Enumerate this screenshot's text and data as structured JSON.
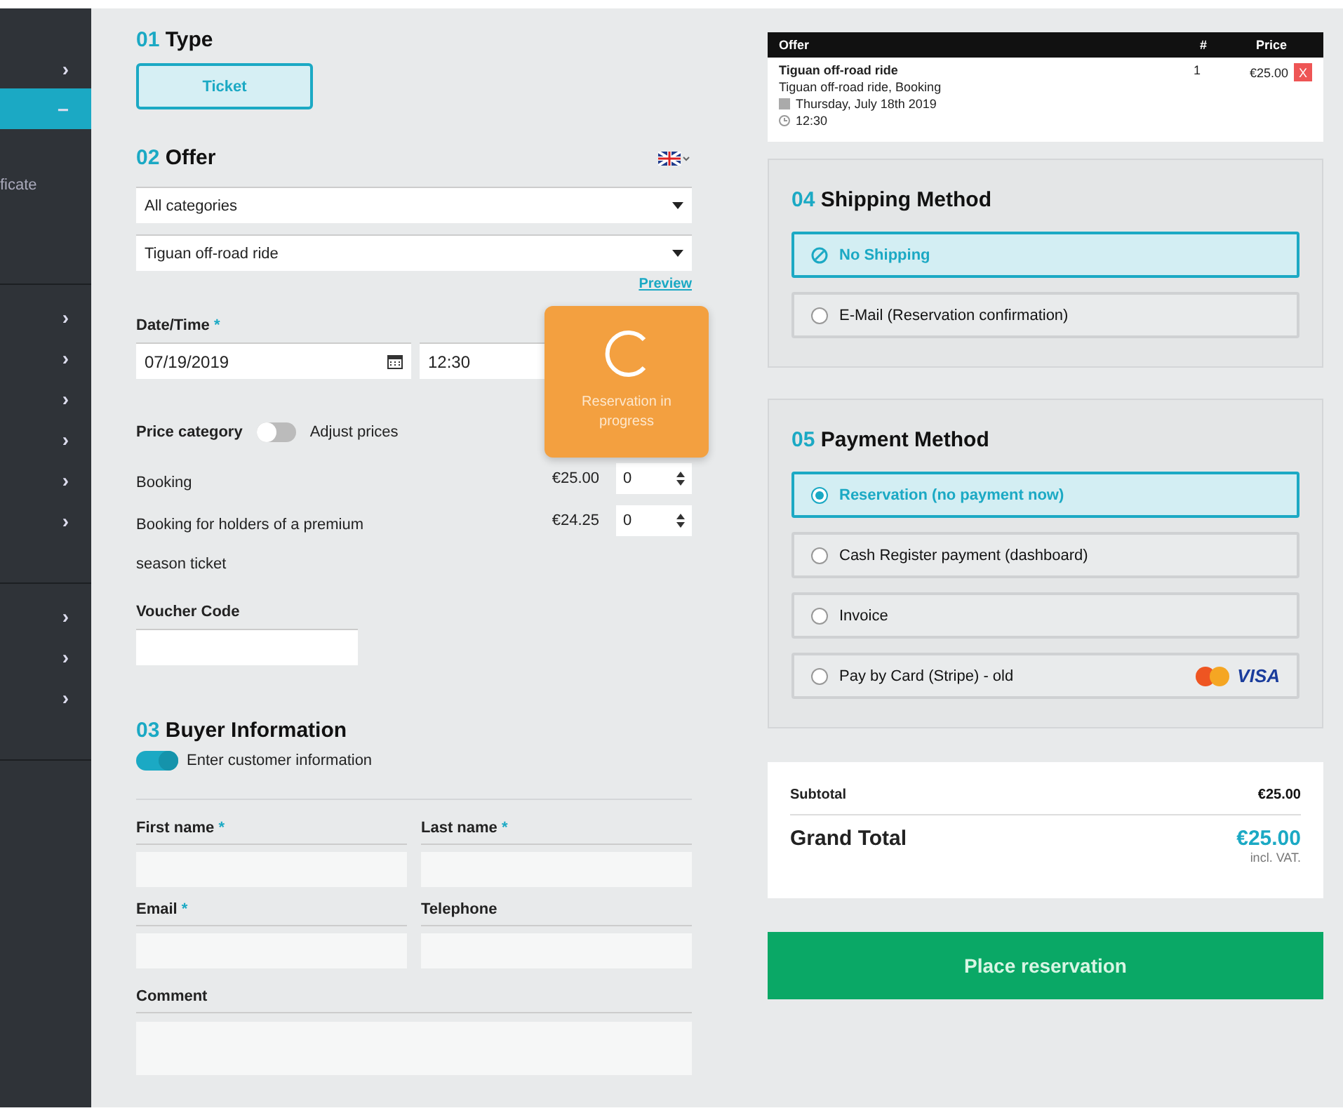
{
  "sidebar": {
    "groups": [
      {
        "items": [
          {
            "kind": "chevron",
            "icon": "›",
            "selected": false
          },
          {
            "kind": "chevron",
            "icon": "−",
            "selected": true
          },
          {
            "kind": "text",
            "label": "ficate",
            "selected": false
          }
        ]
      },
      {
        "items": [
          {
            "kind": "chevron",
            "icon": "›",
            "selected": false
          },
          {
            "kind": "chevron",
            "icon": "›",
            "selected": false
          },
          {
            "kind": "chevron",
            "icon": "›",
            "selected": false
          },
          {
            "kind": "chevron",
            "icon": "›",
            "selected": false
          },
          {
            "kind": "chevron",
            "icon": "›",
            "selected": false
          },
          {
            "kind": "chevron",
            "icon": "›",
            "selected": false
          }
        ]
      },
      {
        "items": [
          {
            "kind": "chevron",
            "icon": "›",
            "selected": false
          },
          {
            "kind": "chevron",
            "icon": "›",
            "selected": false
          },
          {
            "kind": "chevron",
            "icon": "›",
            "selected": false
          }
        ]
      }
    ]
  },
  "type_section": {
    "number": "01",
    "title": "Type",
    "options": [
      {
        "label": "Ticket",
        "selected": true
      }
    ]
  },
  "offer_section": {
    "number": "02",
    "title": "Offer",
    "category_select": "All categories",
    "offer_select": "Tiguan off-road ride",
    "preview_link": "Preview",
    "datetime_label": "Date/Time",
    "required_mark": "*",
    "date_value": "07/19/2019",
    "time_value": "12:30",
    "price_category_label": "Price category",
    "adjust_prices": {
      "label": "Adjust prices",
      "on": false
    },
    "prices": [
      {
        "name": "Booking",
        "price": "€25.00",
        "quantity": "0"
      },
      {
        "name": "Booking for holders of a premium season ticket",
        "price": "€24.25",
        "quantity": "0"
      }
    ],
    "voucher_label": "Voucher Code"
  },
  "buyer_section": {
    "number": "03",
    "title": "Buyer Information",
    "enter_info": {
      "label": "Enter customer information",
      "on": true
    },
    "fields": [
      {
        "label": "First name",
        "required": true
      },
      {
        "label": "Last name",
        "required": true
      },
      {
        "label": "Email",
        "required": true
      },
      {
        "label": "Telephone",
        "required": false
      }
    ],
    "comment_label": "Comment"
  },
  "progress_overlay": {
    "message": "Reservation in progress"
  },
  "cart": {
    "columns": [
      "Offer",
      "#",
      "Price"
    ],
    "rows": [
      {
        "title": "Tiguan off-road ride",
        "subtitle": "Tiguan off-road ride, Booking",
        "date": "Thursday, July 18th 2019",
        "time": "12:30",
        "quantity": "1",
        "price": "€25.00",
        "remove": "X"
      }
    ]
  },
  "shipping_section": {
    "number": "04",
    "title": "Shipping Method",
    "options": [
      {
        "kind": "none",
        "label": "No Shipping",
        "selected": true
      },
      {
        "kind": "radio",
        "label": "E-Mail (Reservation confirmation)",
        "selected": false
      }
    ]
  },
  "payment_section": {
    "number": "05",
    "title": "Payment Method",
    "options": [
      {
        "label": "Reservation (no payment now)",
        "selected": true,
        "cards": false
      },
      {
        "label": "Cash Register payment (dashboard)",
        "selected": false,
        "cards": false
      },
      {
        "label": "Invoice",
        "selected": false,
        "cards": false
      },
      {
        "label": "Pay by Card (Stripe) - old",
        "selected": false,
        "cards": true
      }
    ],
    "card_brand": "VISA"
  },
  "totals": {
    "subtotal_label": "Subtotal",
    "subtotal": "€25.00",
    "grand_total_label": "Grand Total",
    "grand_total": "€25.00",
    "vat_note": "incl. VAT."
  },
  "place_button": "Place reservation"
}
